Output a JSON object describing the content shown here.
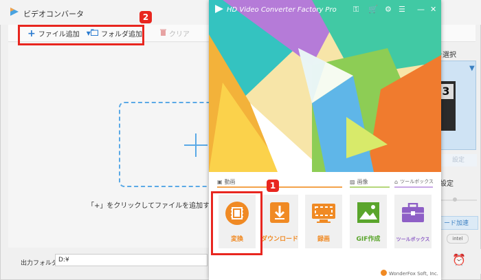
{
  "background_window": {
    "title": "ビデオコンバータ",
    "toolbar": {
      "add_file": "ファイル追加",
      "add_folder": "フォルダ追加",
      "clear": "クリア"
    },
    "drop_hint": "「+」をクリックしてファイルを追加するか、また",
    "output_folder_label": "出力フォルダ：",
    "output_folder_value": "D:¥",
    "right_panel": {
      "select_label": "を選択",
      "preview_number": "3",
      "disabled_button": "設定",
      "setting_label": "設定",
      "accel_button": "ード加速",
      "intel_badge": "intel"
    }
  },
  "launcher": {
    "title": "HD Video Converter Factory Pro",
    "sections": {
      "video": "動画",
      "image": "画像",
      "toolbox": "ツールボックス"
    },
    "tiles": [
      {
        "label": "変換",
        "color": "#f08a24"
      },
      {
        "label": "ダウンロード",
        "color": "#f08a24"
      },
      {
        "label": "録画",
        "color": "#f08a24"
      },
      {
        "label": "GIF作成",
        "color": "#5aa52c"
      },
      {
        "label": "ツールボックス",
        "color": "#8e5fc6"
      }
    ],
    "footer": "WonderFox Soft, Inc."
  },
  "annotations": {
    "badge_1": "1",
    "badge_2": "2"
  },
  "colors": {
    "accent_blue": "#5aa9e6",
    "annotation_red": "#e8261f",
    "orange": "#f08a24",
    "green": "#5aa52c",
    "purple": "#8e5fc6"
  }
}
